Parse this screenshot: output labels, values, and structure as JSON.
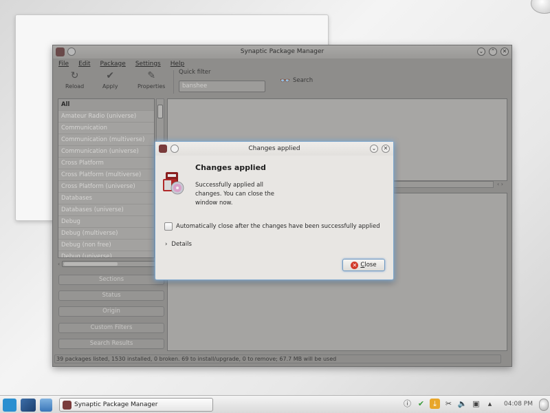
{
  "main_window": {
    "title": "Synaptic Package Manager",
    "menu": [
      "File",
      "Edit",
      "Package",
      "Settings",
      "Help"
    ],
    "toolbar": {
      "reload": "Reload",
      "apply": "Apply",
      "properties": "Properties",
      "quick_filter_label": "Quick filter",
      "quick_filter_value": "banshee",
      "search": "Search"
    },
    "categories": [
      "All",
      "Amateur Radio (universe)",
      "Communication",
      "Communication (multiverse)",
      "Communication (universe)",
      "Cross Platform",
      "Cross Platform (multiverse)",
      "Cross Platform (universe)",
      "Databases",
      "Databases (universe)",
      "Debug",
      "Debug (multiverse)",
      "Debug (non free)",
      "Debug (universe)"
    ],
    "side_buttons": [
      "Sections",
      "Status",
      "Origin",
      "Custom Filters",
      "Search Results"
    ],
    "status_bar": "39 packages listed, 1530 installed, 0 broken. 69 to install/upgrade, 0 to remove; 67.7 MB will be used"
  },
  "dialog": {
    "title": "Changes applied",
    "heading": "Changes applied",
    "message": "Successfully applied all changes. You can close the window now.",
    "auto_close_label": "Automatically close after the changes have been successfully applied",
    "details_label": "Details",
    "close_label": "Close"
  },
  "taskbar": {
    "task_label": "Synaptic Package Manager",
    "clock": "04:08 PM"
  }
}
